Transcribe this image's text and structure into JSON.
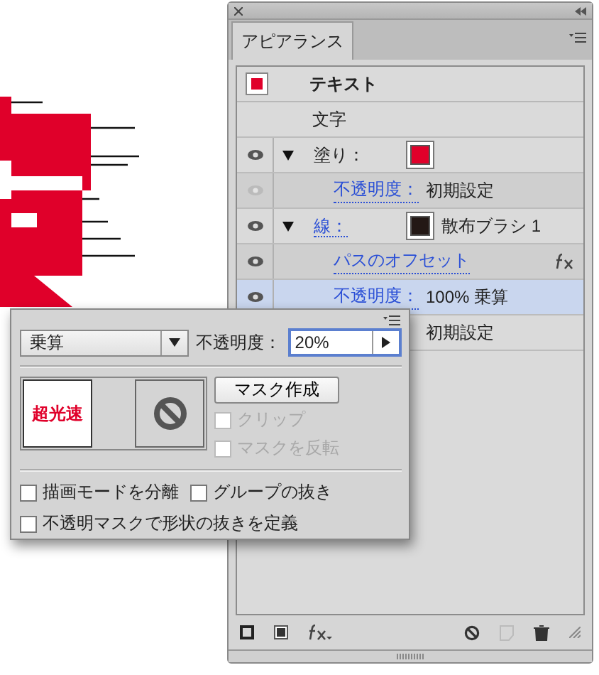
{
  "panel": {
    "title": "アピアランス",
    "header": {
      "title": "テキスト",
      "color": "#e0002a"
    },
    "rows": [
      {
        "kind": "plain",
        "label": "文字"
      },
      {
        "kind": "attribute",
        "label": "塗り：",
        "expanded": true,
        "eye_enabled": true,
        "color": "#e0002a",
        "selected": false
      },
      {
        "kind": "sub",
        "label": "不透明度：",
        "value": "初期設定",
        "eye_enabled": false,
        "selected": false
      },
      {
        "kind": "attribute",
        "label": "線：",
        "value": "散布ブラシ 1",
        "expanded": true,
        "eye_enabled": true,
        "color": "#231815",
        "selected": false
      },
      {
        "kind": "effect",
        "label": "パスのオフセット",
        "eye_enabled": true,
        "selected": false
      },
      {
        "kind": "sub",
        "label": "不透明度：",
        "value": "100% 乗算",
        "eye_enabled": true,
        "selected": true
      },
      {
        "kind": "covered",
        "value": "初期設定"
      }
    ]
  },
  "transparency": {
    "blend_mode": "乗算",
    "opacity_label": "不透明度：",
    "opacity": "20%",
    "thumbnail_text": "超光速",
    "mask_button": "マスク作成",
    "mask_options": [
      {
        "label": "クリップ",
        "checked": false,
        "disabled": true
      },
      {
        "label": "マスクを反転",
        "checked": false,
        "disabled": true
      }
    ],
    "options": [
      {
        "label": "描画モードを分離",
        "checked": false
      },
      {
        "label": "グループの抜き",
        "checked": false
      },
      {
        "label": "不透明マスクで形状の抜きを定義",
        "checked": false
      }
    ]
  }
}
